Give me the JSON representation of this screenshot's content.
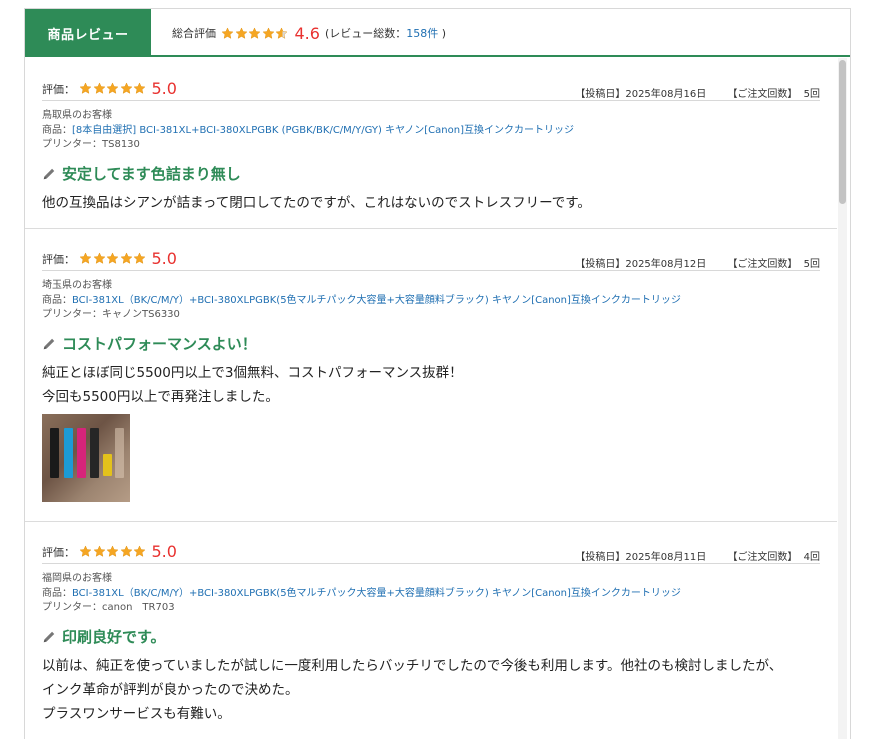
{
  "header": {
    "tab_label": "商品レビュー",
    "summary_label": "総合評価",
    "summary_stars": 4.6,
    "summary_score": "4.6",
    "review_count_prefix": "(レビュー総数：",
    "review_count_link": "158件",
    "review_count_suffix": ")"
  },
  "reviews": [
    {
      "rating_label": "評価：",
      "stars": 5,
      "score": "5.0",
      "posted": "【投稿日】2025年08月16日",
      "orders_label": "【ご注文回数】",
      "orders_value": "5回",
      "customer": "鳥取県のお客様",
      "product_prefix": "商品：",
      "product": "[8本自由選択] BCI-381XL+BCI-380XLPGBK (PGBK/BK/C/M/Y/GY) キヤノン[Canon]互換インクカートリッジ",
      "printer": "プリンター：TS8130",
      "title": "安定してます色詰まり無し",
      "body": [
        "他の互換品はシアンが詰まって閉口してたのですが、これはないのでストレスフリーです。"
      ]
    },
    {
      "rating_label": "評価：",
      "stars": 5,
      "score": "5.0",
      "posted": "【投稿日】2025年08月12日",
      "orders_label": "【ご注文回数】",
      "orders_value": "5回",
      "customer": "埼玉県のお客様",
      "product_prefix": "商品：",
      "product": "BCI-381XL（BK/C/M/Y）+BCI-380XLPGBK(5色マルチパック大容量+大容量顔料ブラック) キヤノン[Canon]互換インクカートリッジ",
      "printer": "プリンター：キャノンTS6330",
      "title": "コストパフォーマンスよい！",
      "body": [
        "純正とほぼ同じ5500円以上で3個無料、コストパフォーマンス抜群！",
        "今回も5500円以上で再発注しました。"
      ]
    },
    {
      "rating_label": "評価：",
      "stars": 5,
      "score": "5.0",
      "posted": "【投稿日】2025年08月11日",
      "orders_label": "【ご注文回数】",
      "orders_value": "4回",
      "customer": "福岡県のお客様",
      "product_prefix": "商品：",
      "product": "BCI-381XL（BK/C/M/Y）+BCI-380XLPGBK(5色マルチパック大容量+大容量顔料ブラック) キヤノン[Canon]互換インクカートリッジ",
      "printer": "プリンター：canon　TR703",
      "title": "印刷良好です。",
      "body": [
        "以前は、純正を使っていましたが試しに一度利用したらバッチリでしたので今後も利用します。他社のも検討しましたが、",
        "インク革命が評判が良かったので決めた。",
        "プラスワンサービスも有難い。"
      ]
    }
  ],
  "colors": {
    "accent_green": "#2e8b57",
    "score_red": "#e8312f",
    "link_blue": "#1f6fb2",
    "star_gold": "#f5a623"
  }
}
